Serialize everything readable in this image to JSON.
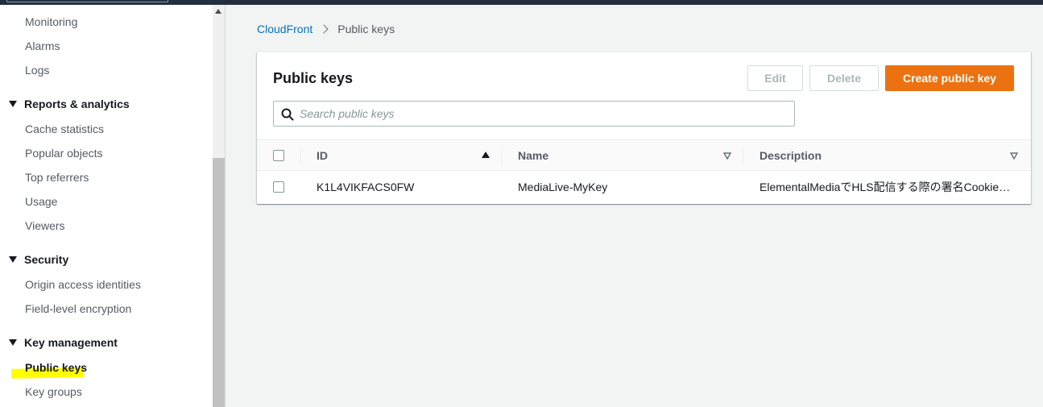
{
  "sidebar": {
    "monitoring_items": [
      "Monitoring",
      "Alarms",
      "Logs"
    ],
    "reports_heading": "Reports & analytics",
    "reports_items": [
      "Cache statistics",
      "Popular objects",
      "Top referrers",
      "Usage",
      "Viewers"
    ],
    "security_heading": "Security",
    "security_items": [
      "Origin access identities",
      "Field-level encryption"
    ],
    "key_heading": "Key management",
    "key_items": [
      "Public keys",
      "Key groups"
    ]
  },
  "breadcrumb": {
    "parent": "CloudFront",
    "current": "Public keys"
  },
  "panel": {
    "title": "Public keys",
    "edit_label": "Edit",
    "delete_label": "Delete",
    "create_label": "Create public key",
    "search_placeholder": "Search public keys"
  },
  "table": {
    "columns": [
      "ID",
      "Name",
      "Description"
    ],
    "rows": [
      {
        "id": "K1L4VIKFACS0FW",
        "name": "MediaLive-MyKey",
        "description": "ElementalMediaでHLS配信する際の署名Cookie…"
      }
    ]
  },
  "colors": {
    "accent": "#ec7211",
    "link": "#0073bb",
    "highlight": "#ffff00"
  }
}
